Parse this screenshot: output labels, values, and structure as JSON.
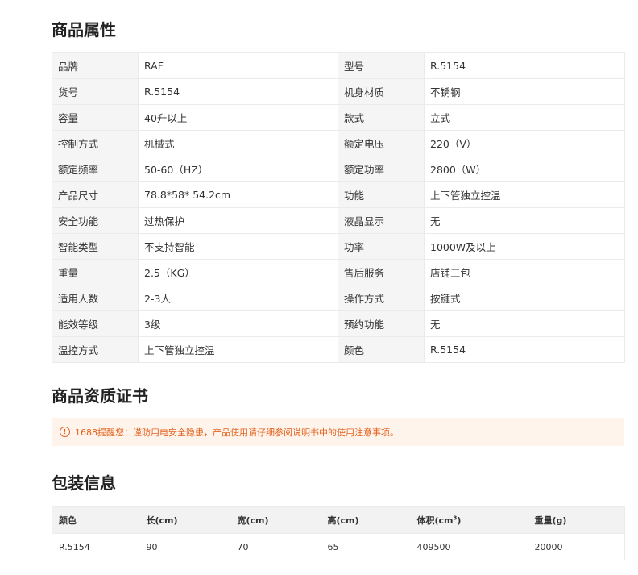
{
  "attributes": {
    "title": "商品属性",
    "rows": [
      {
        "k1": "品牌",
        "v1": "RAF",
        "k2": "型号",
        "v2": "R.5154"
      },
      {
        "k1": "货号",
        "v1": "R.5154",
        "k2": "机身材质",
        "v2": "不锈钢"
      },
      {
        "k1": "容量",
        "v1": "40升以上",
        "k2": "款式",
        "v2": "立式"
      },
      {
        "k1": "控制方式",
        "v1": "机械式",
        "k2": "额定电压",
        "v2": "220（V）"
      },
      {
        "k1": "额定频率",
        "v1": "50-60（HZ）",
        "k2": "额定功率",
        "v2": "2800（W）"
      },
      {
        "k1": "产品尺寸",
        "v1": "78.8*58* 54.2cm",
        "k2": "功能",
        "v2": "上下管独立控温"
      },
      {
        "k1": "安全功能",
        "v1": "过热保护",
        "k2": "液晶显示",
        "v2": "无"
      },
      {
        "k1": "智能类型",
        "v1": "不支持智能",
        "k2": "功率",
        "v2": "1000W及以上"
      },
      {
        "k1": "重量",
        "v1": "2.5（KG）",
        "k2": "售后服务",
        "v2": "店铺三包"
      },
      {
        "k1": "适用人数",
        "v1": "2-3人",
        "k2": "操作方式",
        "v2": "按键式"
      },
      {
        "k1": "能效等级",
        "v1": "3级",
        "k2": "预约功能",
        "v2": "无"
      },
      {
        "k1": "温控方式",
        "v1": "上下管独立控温",
        "k2": "颜色",
        "v2": "R.5154"
      }
    ]
  },
  "certificate": {
    "title": "商品资质证书",
    "notice_icon": "!",
    "notice": "1688提醒您：谨防用电安全隐患，产品使用请仔细参阅说明书中的使用注意事项。",
    "notice_color": "#e2611d",
    "notice_bg": "#fff4ec"
  },
  "packaging": {
    "title": "包装信息",
    "headers": {
      "color": "颜色",
      "length": "长(cm)",
      "width": "宽(cm)",
      "height": "高(cm)",
      "volume": "体积(cm",
      "volume_sup": "3",
      "volume_close": ")",
      "weight": "重量(g)"
    },
    "rows": [
      {
        "color": "R.5154",
        "length": "90",
        "width": "70",
        "height": "65",
        "volume": "409500",
        "weight": "20000"
      }
    ]
  }
}
